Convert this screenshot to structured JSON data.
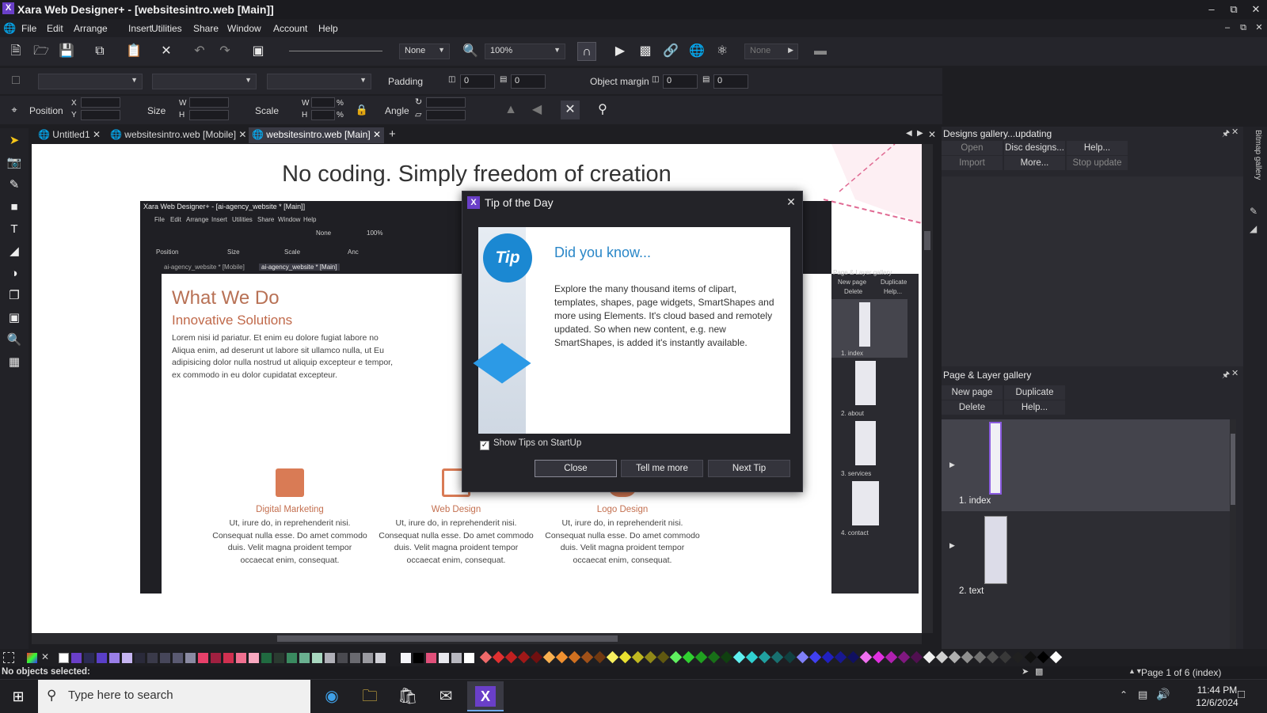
{
  "window": {
    "title": "Xara Web Designer+ - [websitesintro.web [Main]]",
    "app_icon": "X"
  },
  "menu": [
    "File",
    "Edit",
    "Arrange",
    "Insert",
    "Utilities",
    "Share",
    "Window",
    "Account",
    "Help"
  ],
  "toolbar": {
    "line_style_value": "None",
    "zoom_value": "100%",
    "fill_value": "None"
  },
  "toolbar2": {
    "padding_label": "Padding",
    "padding_h": "0",
    "padding_v": "0",
    "object_margin_label": "Object margin",
    "margin_h": "0",
    "margin_v": "0"
  },
  "infobar": {
    "position_label": "Position",
    "x_label": "X",
    "y_label": "Y",
    "size_label": "Size",
    "w_label": "W",
    "h_label": "H",
    "scale_label": "Scale",
    "scale_w_label": "W",
    "scale_h_label": "H",
    "percent": "%",
    "angle_label": "Angle"
  },
  "tabs": [
    {
      "label": "Untitled1"
    },
    {
      "label": "websitesintro.web [Mobile]"
    },
    {
      "label": "websitesintro.web [Main]"
    }
  ],
  "canvas": {
    "heading": "No coding. Simply freedom of creation",
    "inner_window_title": "Xara Web Designer+ - [ai-agency_website * [Main]]",
    "inner_menu": [
      "File",
      "Edit",
      "Arrange",
      "Insert",
      "Utilities",
      "Share",
      "Window",
      "Help"
    ],
    "inner_zoom": "100%",
    "inner_none": "None",
    "inner_position": "Position",
    "inner_size": "Size",
    "inner_scale": "Scale",
    "inner_angle": "Anc",
    "inner_tab1": "ai-agency_website * [Mobile]",
    "inner_tab2": "ai-agency_website * [Main]",
    "inner_gallery_title": "Page & Layer gallery",
    "inner_gallery_new": "New page",
    "inner_gallery_dup": "Duplicate",
    "inner_gallery_del": "Delete",
    "inner_gallery_help": "Help...",
    "inner_pages": [
      "1. index",
      "2. about",
      "3. services",
      "4. contact"
    ],
    "section_title": "What We Do",
    "section_sub": "Innovative Solutions",
    "lorem": "Lorem nisi id pariatur. Et enim eu dolore fugiat labore no Aliqua enim, ad deserunt ut labore sit ullamco nulla, ut Eu adipisicing dolor nulla nostrud ut aliquip excepteur e tempor, ex commodo in eu dolor cupidatat excepteur.",
    "services": [
      {
        "title": "Digital Marketing",
        "text": "Ut, irure do, in reprehenderit nisi. Consequat nulla esse. Do amet commodo duis. Velit magna proident tempor occaecat enim, consequat."
      },
      {
        "title": "Web Design",
        "text": "Ut, irure do, in reprehenderit nisi. Consequat nulla esse. Do amet commodo duis. Velit magna proident tempor occaecat enim, consequat."
      },
      {
        "title": "Logo Design",
        "text": "Ut, irure do, in reprehenderit nisi. Consequat nulla esse. Do amet commodo duis. Velit magna proident tempor occaecat enim, consequat."
      }
    ]
  },
  "dialog": {
    "title": "Tip of the Day",
    "tip_badge": "Tip",
    "heading": "Did you know...",
    "text": "Explore the many thousand items of clipart, templates, shapes, page widgets, SmartShapes and more using Elements. It's cloud based and remotely updated. So when new content, e.g. new SmartShapes, is added it's instantly available.",
    "show_tips_label": "Show Tips on StartUp",
    "show_tips_checked": true,
    "buttons": {
      "close": "Close",
      "tell_me_more": "Tell me more",
      "next_tip": "Next Tip"
    }
  },
  "designs_gallery": {
    "title": "Designs gallery...updating",
    "open": "Open",
    "disc": "Disc designs...",
    "help": "Help...",
    "import": "Import",
    "more": "More...",
    "stop": "Stop update"
  },
  "page_gallery": {
    "title": "Page & Layer gallery",
    "new_page": "New page",
    "duplicate": "Duplicate",
    "delete": "Delete",
    "help": "Help...",
    "pages": [
      "1. index",
      "2. text"
    ]
  },
  "side_tab": "Bitmap gallery",
  "status": {
    "left": "No objects selected:",
    "right": "Page 1 of 6 (index)"
  },
  "taskbar": {
    "search_placeholder": "Type here to search",
    "time": "11:44 PM",
    "date": "12/6/2024"
  },
  "colors": {
    "accent_purple": "#6a3fc8",
    "tip_blue": "#2a87c8",
    "brand_orange": "#c0694a"
  }
}
